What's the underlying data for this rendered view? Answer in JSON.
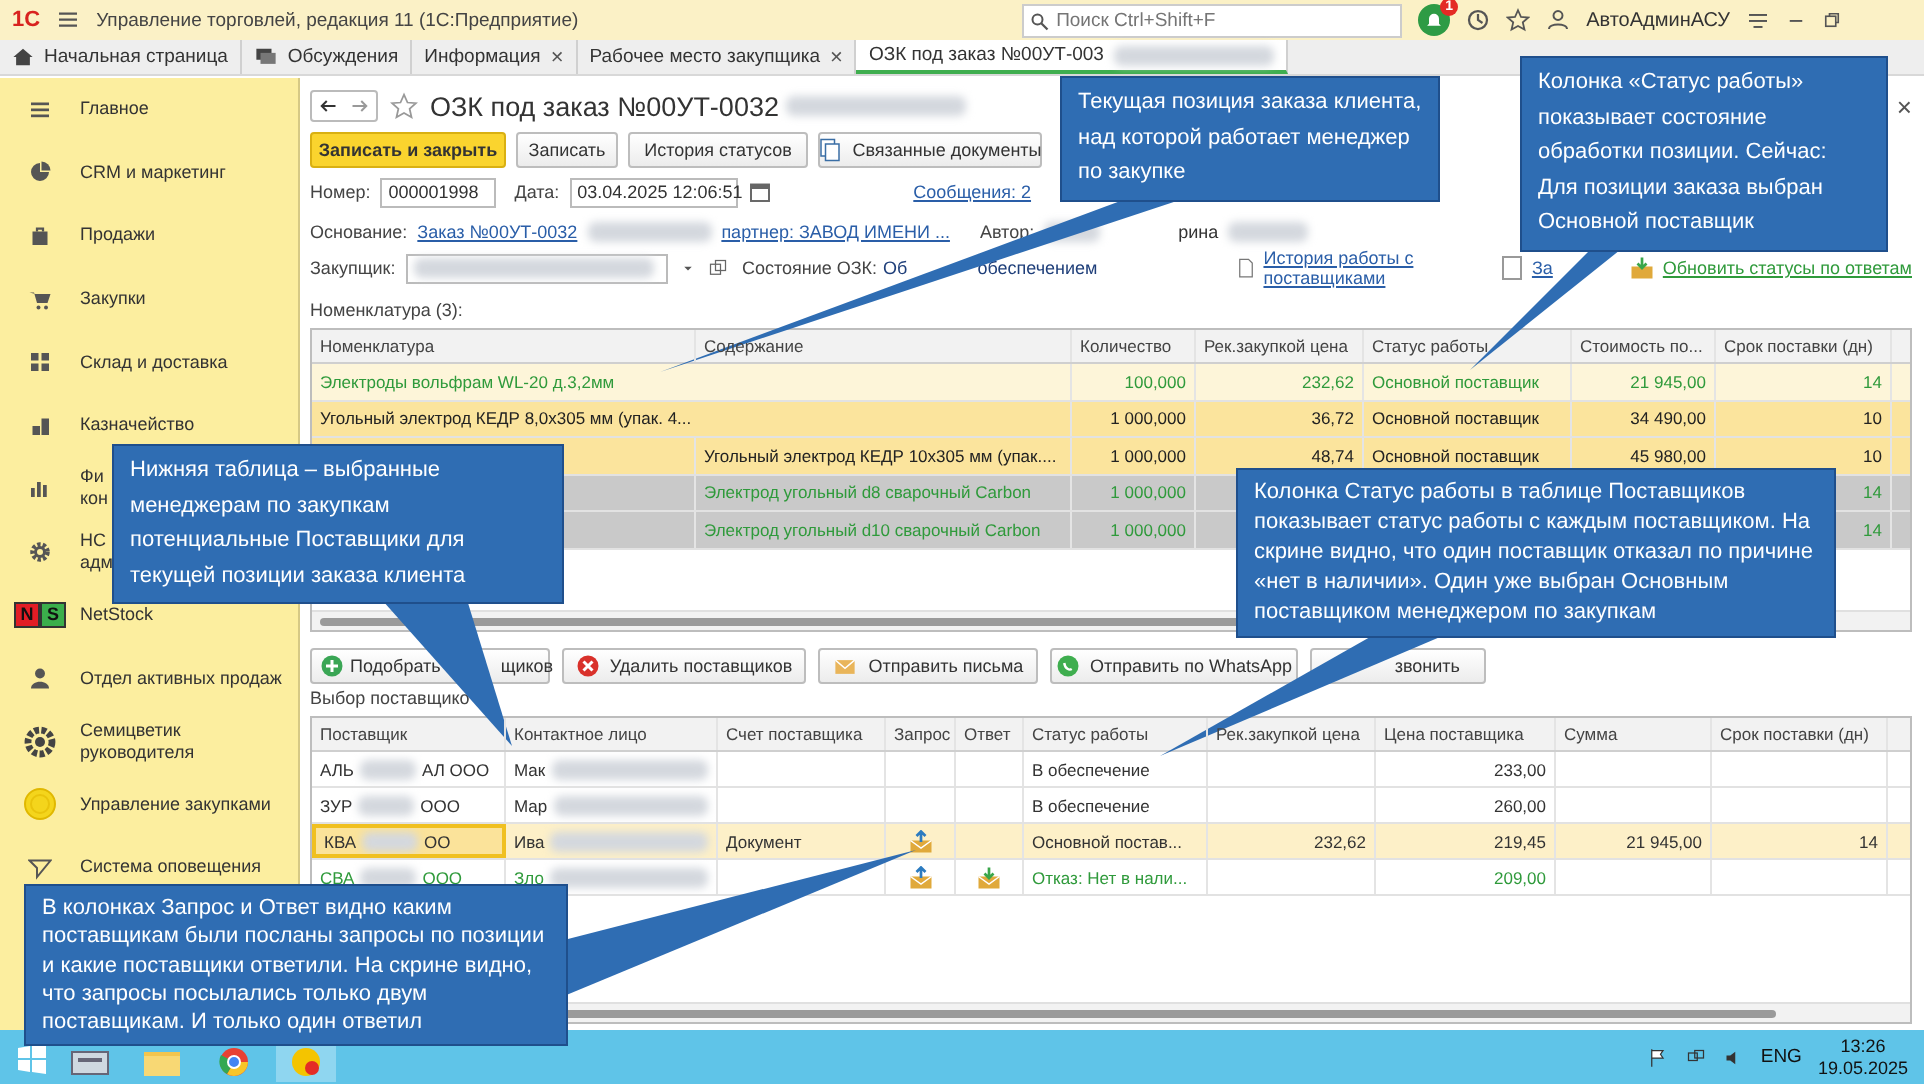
{
  "window": {
    "logo": "1С",
    "title": "Управление торговлей, редакция 11  (1С:Предприятие)",
    "search": {
      "placeholder": "Поиск Ctrl+Shift+F"
    },
    "notifications_badge": "1",
    "user": "АвтоАдминАСУ"
  },
  "tabs": [
    {
      "label": "Начальная страница",
      "kind": "home",
      "selected": false
    },
    {
      "label": "Обсуждения",
      "kind": "chat",
      "selected": false
    },
    {
      "label": "Информация",
      "kind": "plain",
      "selected": false,
      "close": "×"
    },
    {
      "label": "Рабочее место закупщика",
      "kind": "plain",
      "selected": false,
      "close": "×"
    },
    {
      "label": "ОЗК под заказ №00УТ-003",
      "kind": "plain",
      "selected": true
    }
  ],
  "sidebar": {
    "items": [
      {
        "kind": "list",
        "lines": [
          "Главное"
        ]
      },
      {
        "kind": "pie",
        "lines": [
          "CRM и маркетинг"
        ]
      },
      {
        "kind": "bag",
        "lines": [
          "Продажи"
        ]
      },
      {
        "kind": "cart",
        "lines": [
          "Закупки"
        ]
      },
      {
        "kind": "warehouse",
        "lines": [
          "Склад и доставка"
        ]
      },
      {
        "kind": "coins",
        "lines": [
          "Казначейство"
        ]
      },
      {
        "kind": "chart",
        "lines": [
          "Фи",
          "кон"
        ]
      },
      {
        "kind": "gear",
        "lines": [
          "НС",
          "адм"
        ]
      },
      {
        "kind": "netstock",
        "logo": [
          "N",
          "S"
        ],
        "lines": [
          "NetStock"
        ]
      },
      {
        "kind": "person",
        "lines": [
          "Отдел активных продаж"
        ]
      },
      {
        "kind": "flower",
        "lines": [
          "Семицветик",
          "руководителя"
        ]
      },
      {
        "kind": "coin",
        "lines": [
          "Управление закупками"
        ]
      },
      {
        "kind": "send",
        "lines": [
          "Система оповещения"
        ]
      }
    ]
  },
  "form": {
    "title": "ОЗК под заказ №00УТ-0032",
    "close": "×",
    "buttons": [
      {
        "label": "Записать и закрыть",
        "kind": "primary"
      },
      {
        "label": "Записать",
        "kind": "plain"
      },
      {
        "label": "История статусов",
        "kind": "plain"
      },
      {
        "label": "Связанные документы",
        "kind": "documents"
      }
    ],
    "number": {
      "label": "Номер:",
      "value": "000001998"
    },
    "date": {
      "label": "Дата:",
      "value": "03.04.2025 12:06:51"
    },
    "messages_link": "Сообщения: 2",
    "basis": {
      "label": "Основание:",
      "link": "Заказ №00УТ-0032",
      "partner_link": "партнер: ЗАВОД ИМЕНИ ..."
    },
    "author": {
      "label": "Автор:",
      "value_fragment": "рина"
    },
    "buyer": {
      "label": "Закупщик:"
    },
    "state": {
      "label": "Состояние ОЗК:",
      "value_parts": [
        "Об",
        "обеспечением"
      ]
    },
    "history_link": "История работы с поставщиками",
    "checkbox": {
      "label": "За",
      "checked": false
    },
    "refresh_link": "Обновить статусы по ответам"
  },
  "items_table": {
    "caption": "Номенклатура (3):",
    "columns": [
      "Номенклатура",
      "Содержание",
      "Количество",
      "Рек.закупкой цена",
      "Статус работы",
      "Стоимость по...",
      "Срок поставки (дн)"
    ],
    "rows": [
      {
        "kind": "current",
        "cells": [
          "Электроды вольфрам WL-20 д.3,2мм",
          null,
          "100,000",
          "232,62",
          "Основной поставщик",
          "21 945,00",
          "14"
        ]
      },
      {
        "kind": "in_work",
        "cells": [
          "Угольный электрод КЕДР 8,0х305 мм (упак. 4...",
          null,
          "1 000,000",
          "36,72",
          "Основной поставщик",
          "34 490,00",
          "10"
        ]
      },
      {
        "kind": "in_work",
        "cells": [
          null,
          "Угольный электрод КЕДР 10х305 мм (упак....",
          "1 000,000",
          "48,74",
          "Основной поставщик",
          "45 980,00",
          "10"
        ]
      },
      {
        "kind": "other",
        "cells": [
          null,
          "Электрод угольный d8 сварочный  Carbon",
          "1 000,000",
          null,
          null,
          null,
          "14"
        ]
      },
      {
        "kind": "other",
        "cells": [
          null,
          "Электрод угольный d10 сварочный Carbon",
          "1 000,000",
          null,
          null,
          null,
          "14"
        ]
      }
    ]
  },
  "supplier_buttons": [
    {
      "kind": "add",
      "label_parts": [
        "Подобрать",
        "щиков"
      ]
    },
    {
      "kind": "delete",
      "label_parts": [
        "Удалить поставщиков"
      ]
    },
    {
      "kind": "mail",
      "label_parts": [
        "Отправить письма"
      ]
    },
    {
      "kind": "whatsapp",
      "label_parts": [
        "Отправить по WhatsApp"
      ]
    },
    {
      "kind": "plain",
      "label_parts": [
        "звонить"
      ]
    }
  ],
  "suppliers_table": {
    "caption": "Выбор поставщико",
    "columns": [
      "Поставщик",
      "Контактное лицо",
      "Счет поставщика",
      "Запрос",
      "Ответ",
      "Статус работы",
      "Рек.закупкой цена",
      "Цена поставщика",
      "Сумма",
      "Срок поставки (дн)"
    ],
    "rows": [
      {
        "supplier": [
          "АЛЬ",
          "АЛ ООО"
        ],
        "contact": "Мак",
        "invoice": null,
        "request_sent": false,
        "response_received": false,
        "status": "В обеспечение",
        "recommended_price": null,
        "supplier_price": "233,00",
        "sum": null,
        "lead_time": null,
        "selected": false,
        "declined": false
      },
      {
        "supplier": [
          "ЗУР",
          "ООО"
        ],
        "contact": "Мар",
        "invoice": null,
        "request_sent": false,
        "response_received": false,
        "status": "В обеспечение",
        "recommended_price": null,
        "supplier_price": "260,00",
        "sum": null,
        "lead_time": null,
        "selected": false,
        "declined": false
      },
      {
        "supplier": [
          "КВА",
          "ОО"
        ],
        "contact": "Ива",
        "invoice": "Документ",
        "request_sent": true,
        "response_received": false,
        "status": "Основной постав...",
        "recommended_price": "232,62",
        "supplier_price": "219,45",
        "sum": "21 945,00",
        "lead_time": "14",
        "selected": true,
        "declined": false
      },
      {
        "supplier": [
          "СВА",
          "ООО"
        ],
        "contact": "Зло",
        "invoice": null,
        "request_sent": true,
        "response_received": true,
        "status": "Отказ: Нет в нали...",
        "recommended_price": null,
        "supplier_price": "209,00",
        "sum": null,
        "lead_time": null,
        "selected": false,
        "declined": true
      }
    ]
  },
  "taskbar": {
    "language": "ENG",
    "time": "13:26",
    "date": "19.05.2025"
  },
  "callouts": [
    {
      "text": "Текущая позиция заказа клиента, над которой работает менеджер по закупке"
    },
    {
      "text": "Колонка «Статус работы» показывает состояние обработки позиции. Сейчас: Для позиции заказа выбран Основной поставщик"
    },
    {
      "text": "Нижняя таблица – выбранные менеджерам по закупкам потенциальные Поставщики для текущей позиции заказа клиента"
    },
    {
      "text": "Колонка Статус работы в таблице Поставщиков показывает статус работы с каждым поставщиком. На скрине видно, что один поставщик отказал по причине «нет в наличии». Один уже выбран Основным поставщиком менеджером по закупкам"
    },
    {
      "text": "В колонках Запрос и Ответ видно каким поставщикам были посланы запросы по позиции и какие поставщики ответили. На скрине видно, что запросы посылались только двум поставщикам. И только один ответил"
    }
  ]
}
